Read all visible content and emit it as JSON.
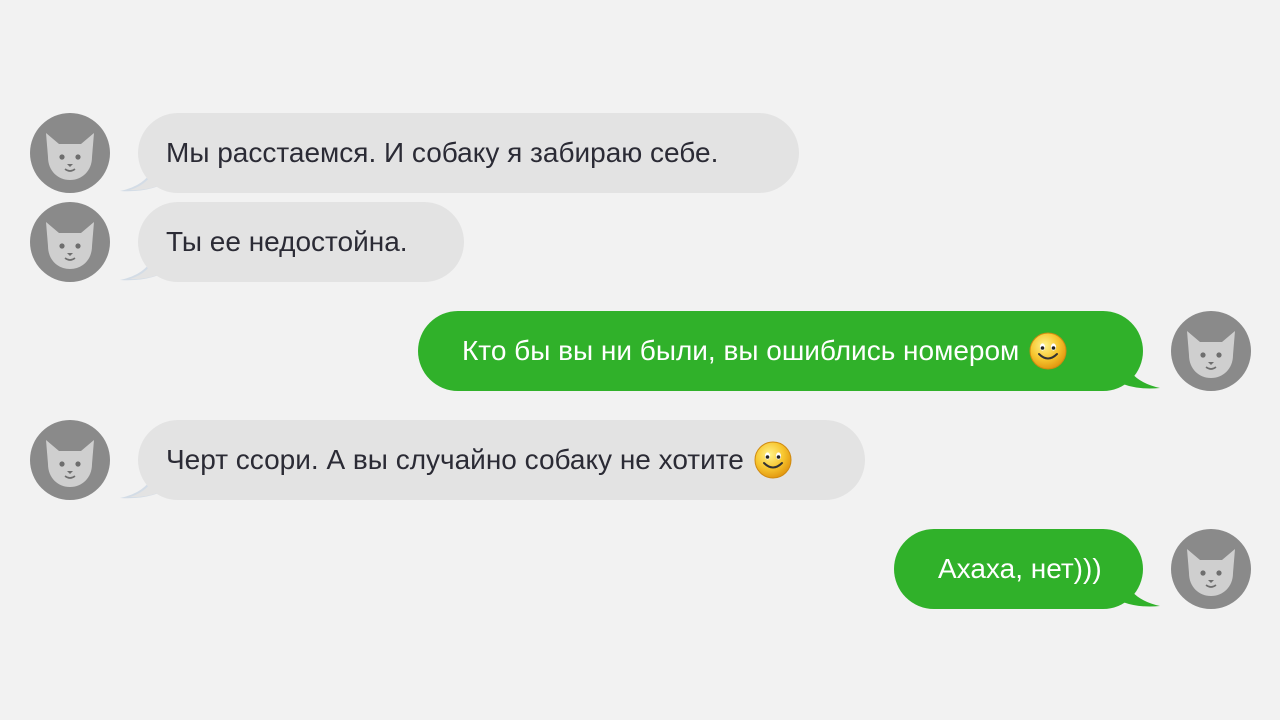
{
  "chat": {
    "messages": [
      {
        "direction": "incoming",
        "text": "Мы расстаемся. И собаку я забираю себе.",
        "emoji": ""
      },
      {
        "direction": "incoming",
        "text": "Ты ее недостойна.",
        "emoji": ""
      },
      {
        "direction": "outgoing",
        "text": "Кто бы вы ни были, вы ошиблись номером",
        "emoji": "smiley-icon"
      },
      {
        "direction": "incoming",
        "text": "Черт ссори. А вы случайно собаку не хотите",
        "emoji": "smiley-icon"
      },
      {
        "direction": "outgoing",
        "text": "Ахаха, нет)))",
        "emoji": ""
      }
    ]
  },
  "colors": {
    "background": "#f2f2f2",
    "incoming_bubble": "#e3e3e3",
    "outgoing_bubble": "#30b12a",
    "avatar": "#8a8a8a",
    "avatar_cat": "#cfcfcf"
  },
  "icons": {
    "avatar": "cat-avatar-icon",
    "emoji": "smiley-icon"
  }
}
